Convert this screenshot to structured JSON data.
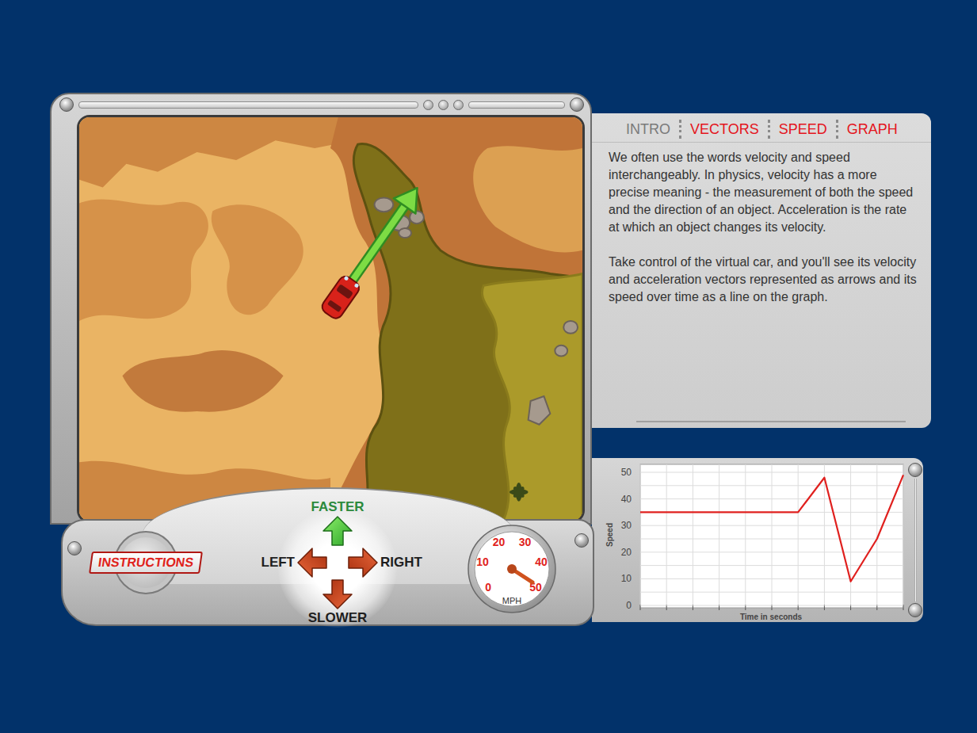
{
  "tabs": [
    {
      "label": "INTRO",
      "selected": true
    },
    {
      "label": "VECTORS",
      "selected": false
    },
    {
      "label": "SPEED",
      "selected": false
    },
    {
      "label": "GRAPH",
      "selected": false
    }
  ],
  "intro": {
    "paragraphs": [
      "We often use the words velocity and speed interchangeably. In physics, velocity has a more precise meaning - the measurement of both the speed and the direction of an object. Acceleration is the rate at which an object changes its velocity.",
      "Take control of the virtual car, and you'll see its velocity and acceleration vectors represented as arrows and its speed over time as a line on the graph."
    ]
  },
  "controls": {
    "instructions": "INSTRUCTIONS",
    "faster": "FASTER",
    "slower": "SLOWER",
    "left": "LEFT",
    "right": "RIGHT"
  },
  "speedometer": {
    "ticks": [
      "0",
      "10",
      "20",
      "30",
      "40",
      "50"
    ],
    "unit": "MPH",
    "value": 49
  },
  "car": {
    "heading": 35
  },
  "graph": {
    "y_label": "Speed",
    "x_label": "Time in seconds",
    "y_ticks": [
      "0",
      "10",
      "20",
      "30",
      "40",
      "50"
    ],
    "series": [
      {
        "name": "speed",
        "values": [
          35,
          35,
          35,
          35,
          35,
          35,
          35,
          48,
          9,
          25,
          49
        ]
      }
    ]
  }
}
